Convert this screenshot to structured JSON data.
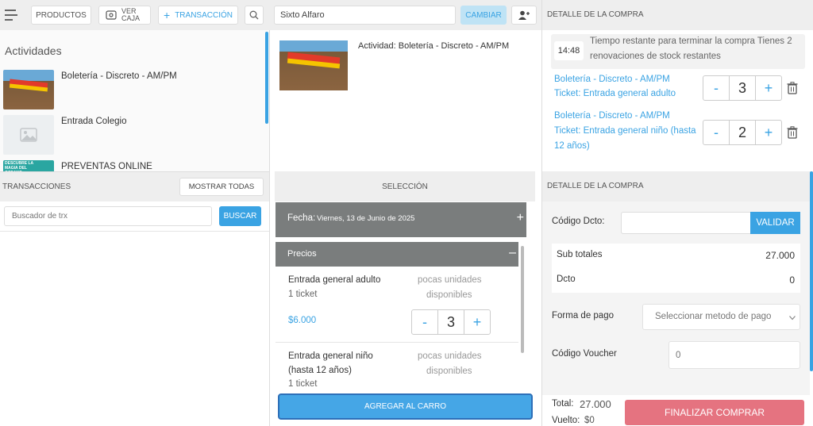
{
  "topbar": {
    "productos": "PRODUCTOS",
    "ver_caja_1": "VER",
    "ver_caja_2": "CAJA",
    "transaccion": "TRANSACCIÓN",
    "client_value": "Sixto Alfaro",
    "cambiar": "CAMBIAR"
  },
  "actividades": {
    "title": "Actividades",
    "items": [
      {
        "label": "Boletería - Discreto - AM/PM"
      },
      {
        "label": "Entrada Colegio"
      },
      {
        "label": "PREVENTAS ONLINE",
        "thumb_text": "DESCUBRE LA MAGIA DEL OCEANO"
      }
    ]
  },
  "transacciones": {
    "title": "TRANSACCIONES",
    "mostrar": "MOSTRAR TODAS",
    "search_placeholder": "Buscador de trx",
    "buscar": "BUSCAR"
  },
  "actividad": {
    "title": "Actividad: Boletería - Discreto - AM/PM"
  },
  "seleccion": {
    "title": "SELECCIÓN",
    "fecha_label": "Fecha:",
    "fecha_value": "Viernes, 13 de Junio de 2025",
    "precios_label": "Precios",
    "items": [
      {
        "name_1": "Entrada general adulto",
        "name_2": "",
        "qty_label": "1 ticket",
        "avail_1": "pocas unidades",
        "avail_2": "disponibles",
        "price": "$6.000",
        "qty": "3"
      },
      {
        "name_1": "Entrada general niño",
        "name_2": "(hasta 12 años)",
        "qty_label": "1 ticket",
        "avail_1": "pocas unidades",
        "avail_2": "disponibles"
      }
    ],
    "agregar": "AGREGAR AL CARRO"
  },
  "detalle_top": {
    "title": "DETALLE DE LA COMPRA",
    "timer": "14:48",
    "timer_text_1": "Tiempo restante para terminar la compra Tienes 2",
    "timer_text_2": "renovaciones de stock restantes",
    "items": [
      {
        "line1": "Boletería - Discreto - AM/PM",
        "line2": "Ticket: Entrada general adulto",
        "line3": "",
        "qty": "3"
      },
      {
        "line1": "Boletería - Discreto - AM/PM",
        "line2": "Ticket: Entrada general niño (hasta",
        "line3": "12 años)",
        "qty": "2"
      }
    ]
  },
  "detalle_bottom": {
    "title": "DETALLE DE LA COMPRA",
    "codigo_label": "Código Dcto:",
    "validar": "VALIDAR",
    "subtotales_label": "Sub totales",
    "subtotales_value": "27.000",
    "dcto_label": "Dcto",
    "dcto_value": "0",
    "forma_pago_label": "Forma de pago",
    "forma_pago_placeholder": "Seleccionar metodo de pago",
    "voucher_label": "Código Voucher",
    "voucher_placeholder": "0",
    "total_label": "Total:",
    "total_value": "27.000",
    "vuelto_label": "Vuelto:",
    "vuelto_value": "$0",
    "finalizar": "FINALIZAR COMPRAR"
  },
  "colors": {
    "accent": "#3aa3e3",
    "header_gray": "#7a7d7d",
    "finalizar": "#e57380"
  }
}
